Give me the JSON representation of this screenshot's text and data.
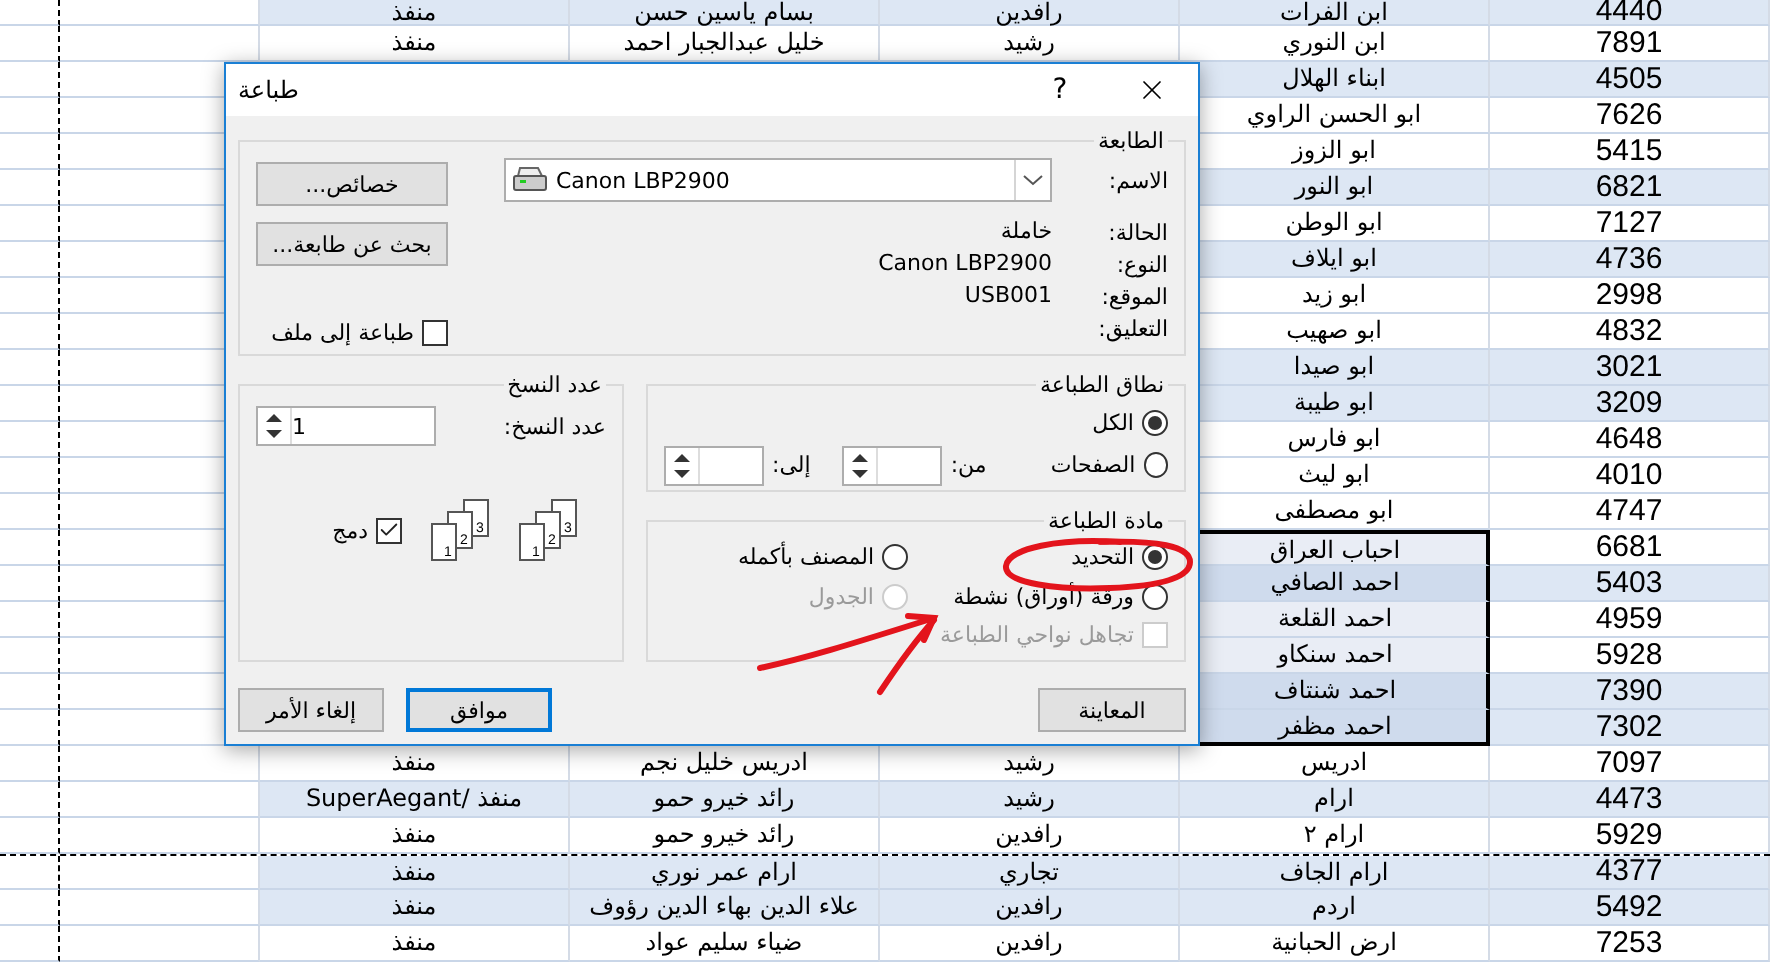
{
  "sheet": {
    "rows": [
      {
        "cells": [
          "4440",
          "ابن الفرات",
          "رافدين",
          "بسام ياسين حسن",
          "منفذ"
        ],
        "shaded": true,
        "selected": false,
        "page_break": false
      },
      {
        "cells": [
          "7891",
          "ابن النوري",
          "رشيد",
          "خليل عبدالجبار احمد",
          "منفذ"
        ],
        "shaded": false,
        "selected": false,
        "page_break": false
      },
      {
        "cells": [
          "4505",
          "ابناء الهلال"
        ],
        "shaded": true,
        "selected": false,
        "page_break": false
      },
      {
        "cells": [
          "7626",
          "ابو الحسن الراوي"
        ],
        "shaded": false,
        "selected": false,
        "page_break": false
      },
      {
        "cells": [
          "5415",
          "ابو الزوز"
        ],
        "shaded": false,
        "selected": false,
        "page_break": false
      },
      {
        "cells": [
          "6821",
          "ابو النور"
        ],
        "shaded": true,
        "selected": false,
        "page_break": false
      },
      {
        "cells": [
          "7127",
          "ابو الوطن"
        ],
        "shaded": false,
        "selected": false,
        "page_break": false
      },
      {
        "cells": [
          "4736",
          "ابو ايلاف"
        ],
        "shaded": true,
        "selected": false,
        "page_break": false
      },
      {
        "cells": [
          "2998",
          "ابو زيد"
        ],
        "shaded": false,
        "selected": false,
        "page_break": false
      },
      {
        "cells": [
          "4832",
          "ابو صهيب"
        ],
        "shaded": false,
        "selected": false,
        "page_break": false
      },
      {
        "cells": [
          "3021",
          "ابو صيدا"
        ],
        "shaded": true,
        "selected": false,
        "page_break": false
      },
      {
        "cells": [
          "3209",
          "ابو طيبة"
        ],
        "shaded": true,
        "selected": false,
        "page_break": false
      },
      {
        "cells": [
          "4648",
          "ابو فارس"
        ],
        "shaded": false,
        "selected": false,
        "page_break": false
      },
      {
        "cells": [
          "4010",
          "ابو ليث"
        ],
        "shaded": false,
        "selected": false,
        "page_break": false
      },
      {
        "cells": [
          "4747",
          "ابو مصطفى"
        ],
        "shaded": false,
        "selected": false,
        "page_break": false
      },
      {
        "cells": [
          "6681",
          "احباب العراق"
        ],
        "shaded": false,
        "selected": true,
        "page_break": false
      },
      {
        "cells": [
          "5403",
          "احمد الصافي"
        ],
        "shaded": true,
        "selected": true,
        "page_break": false
      },
      {
        "cells": [
          "4959",
          "احمد القلعة"
        ],
        "shaded": false,
        "selected": true,
        "page_break": false
      },
      {
        "cells": [
          "5928",
          "احمد سنكاو"
        ],
        "shaded": false,
        "selected": true,
        "page_break": false
      },
      {
        "cells": [
          "7390",
          "احمد شنتاف"
        ],
        "shaded": true,
        "selected": true,
        "page_break": false
      },
      {
        "cells": [
          "7302",
          "احمد مظفر"
        ],
        "shaded": true,
        "selected": true,
        "page_break": false
      },
      {
        "cells": [
          "7097",
          "ادريس",
          "رشيد",
          "ادريس خليل نجم",
          "منفذ"
        ],
        "shaded": false,
        "selected": false,
        "page_break": false
      },
      {
        "cells": [
          "4473",
          "ارام",
          "رشيد",
          "رائد خيرو حمو",
          "منفذ /SuperAegant"
        ],
        "shaded": true,
        "selected": false,
        "page_break": false
      },
      {
        "cells": [
          "5929",
          "ارام ٢",
          "رافدين",
          "رائد خيرو حمو",
          "منفذ"
        ],
        "shaded": false,
        "selected": false,
        "page_break": false
      },
      {
        "cells": [
          "4377",
          "ارام الجاف",
          "تجاري",
          "ارام عمر نوري",
          "منفذ"
        ],
        "shaded": true,
        "selected": false,
        "page_break": true
      },
      {
        "cells": [
          "5492",
          "اردم",
          "رافدين",
          "علاء الدين بهاء الدين رؤوف",
          "منفذ"
        ],
        "shaded": true,
        "selected": false,
        "page_break": false
      },
      {
        "cells": [
          "7253",
          "ارض الحبانية",
          "رافدين",
          "ضياء سليم عواد",
          "منفذ"
        ],
        "shaded": false,
        "selected": false,
        "page_break": false
      }
    ]
  },
  "dialog": {
    "title": "طباعة",
    "help": "?",
    "printer": {
      "legend": "الطابعة",
      "fields": [
        {
          "label": "الاسم:",
          "value": "Canon LBP2900",
          "kind": "select"
        },
        {
          "label": "الحالة:",
          "value": "خاملة",
          "kind": "text"
        },
        {
          "label": "النوع:",
          "value": "Canon LBP2900",
          "kind": "text"
        },
        {
          "label": "الموقع:",
          "value": "USB001",
          "kind": "text"
        },
        {
          "label": "التعليق:",
          "kind": "text"
        }
      ],
      "buttons": [
        "خصائص...",
        "بحث عن طابعة..."
      ],
      "print_to_file": {
        "label": "طباعة إلى ملف",
        "checked": false
      }
    },
    "range": {
      "legend": "نطاق الطباعة",
      "options": [
        {
          "label": "الكل",
          "selected": true,
          "kind": "all"
        },
        {
          "label": "الصفحات",
          "selected": false,
          "kind": "pages"
        }
      ],
      "from_label": "من:",
      "to_label": "إلى:"
    },
    "what": {
      "legend": "مادة الطباعة",
      "options": [
        {
          "label": "التحديد",
          "selected": true,
          "disabled": false
        },
        {
          "label": "المصنف بأكمله",
          "selected": false,
          "disabled": false
        },
        {
          "label": "ورقة (أوراق) نشطة",
          "selected": false,
          "disabled": false
        },
        {
          "label": "الجدول",
          "selected": false,
          "disabled": true
        }
      ],
      "ignore_print_areas": {
        "label": "تجاهل نواحي الطباعة",
        "checked": false,
        "disabled": true
      }
    },
    "copies": {
      "legend": "عدد النسخ",
      "label": "عدد النسخ:",
      "value": "1",
      "stacks": [
        {
          "pages": [
            "1",
            "2",
            "3"
          ]
        },
        {
          "pages": [
            "1",
            "2",
            "3"
          ]
        }
      ],
      "collate": {
        "label": "دمج",
        "checked": true
      }
    },
    "buttons": [
      {
        "label": "المعاينة",
        "default": false,
        "kind": "left"
      },
      {
        "label": "موافق",
        "default": true,
        "kind": "right"
      },
      {
        "label": "إلغاء الأمر",
        "default": false,
        "kind": "right"
      }
    ]
  }
}
